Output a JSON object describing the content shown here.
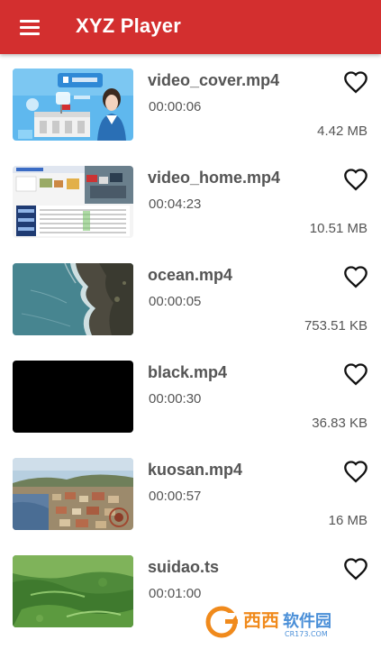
{
  "app": {
    "title": "XYZ Player",
    "accent_color": "#d32f2f",
    "menu_icon": "hamburger-menu-icon"
  },
  "videos": [
    {
      "name": "video_cover.mp4",
      "duration": "00:00:06",
      "size": "4.42 MB",
      "favorite_icon": "heart-outline-icon"
    },
    {
      "name": "video_home.mp4",
      "duration": "00:04:23",
      "size": "10.51 MB",
      "favorite_icon": "heart-outline-icon"
    },
    {
      "name": "ocean.mp4",
      "duration": "00:00:05",
      "size": "753.51 KB",
      "favorite_icon": "heart-outline-icon"
    },
    {
      "name": "black.mp4",
      "duration": "00:00:30",
      "size": "36.83 KB",
      "favorite_icon": "heart-outline-icon"
    },
    {
      "name": "kuosan.mp4",
      "duration": "00:00:57",
      "size": "16 MB",
      "favorite_icon": "heart-outline-icon"
    },
    {
      "name": "suidao.ts",
      "duration": "00:01:00",
      "size": "",
      "favorite_icon": "heart-outline-icon"
    }
  ],
  "watermark": {
    "text": "西西软件园",
    "subtext": "CR173.COM"
  }
}
